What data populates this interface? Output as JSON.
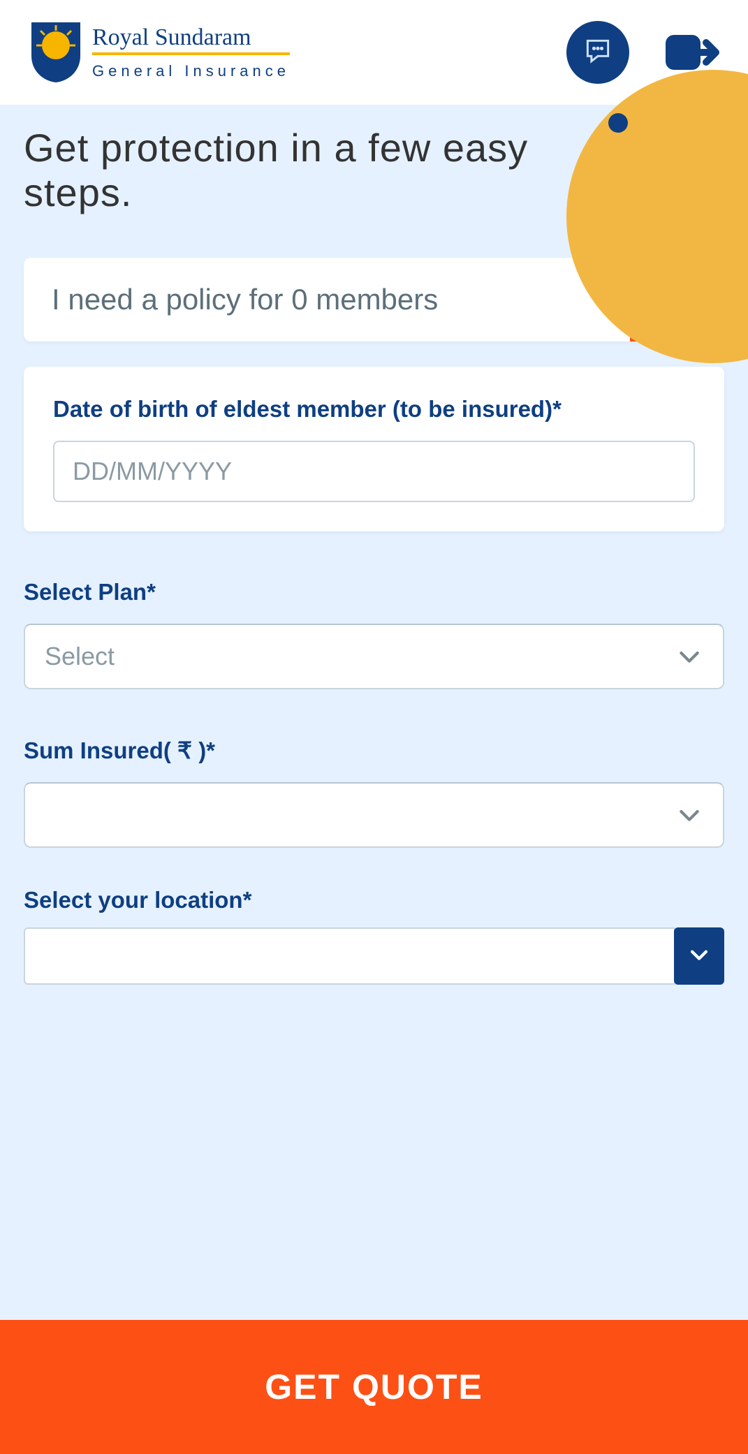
{
  "header": {
    "brand_main": "Royal Sundaram",
    "brand_sub": "General Insurance"
  },
  "page": {
    "title": "Get protection in a few easy steps."
  },
  "members": {
    "text": "I need a policy for 0 members"
  },
  "form": {
    "dob": {
      "label": "Date of birth of eldest member (to be insured)*",
      "placeholder": "DD/MM/YYYY",
      "value": ""
    },
    "plan": {
      "label": "Select Plan*",
      "placeholder": "Select",
      "value": ""
    },
    "sum_insured": {
      "label": "Sum Insured( ₹ )*",
      "placeholder": "",
      "value": ""
    },
    "location": {
      "label": "Select your location*",
      "value": ""
    }
  },
  "cta": {
    "label": "GET QUOTE"
  }
}
